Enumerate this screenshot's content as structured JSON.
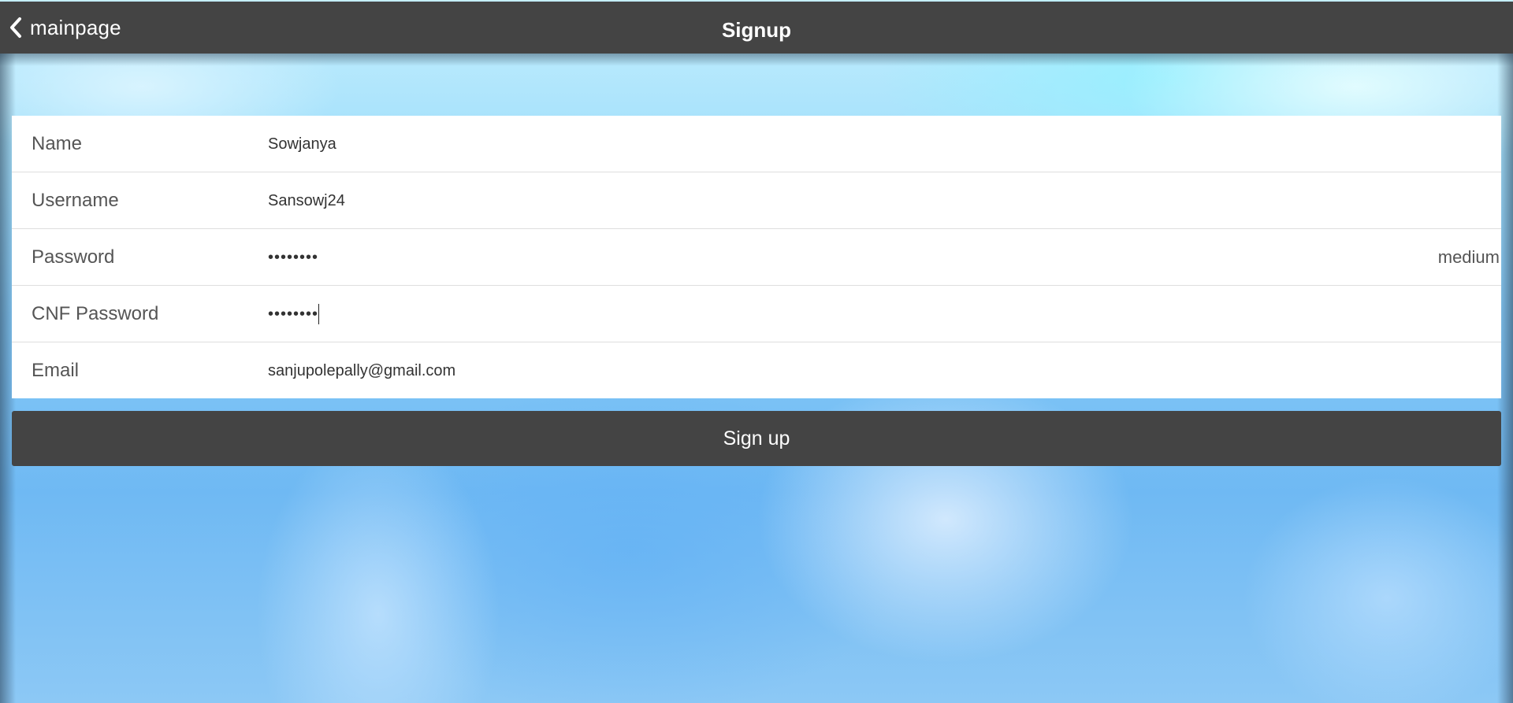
{
  "header": {
    "back_label": "mainpage",
    "back_icon": "chevron-left-icon",
    "title": "Signup"
  },
  "form": {
    "fields": [
      {
        "label": "Name",
        "value": "Sowjanya",
        "type": "text"
      },
      {
        "label": "Username",
        "value": "Sansowj24",
        "type": "text"
      },
      {
        "label": "Password",
        "value": "••••••••",
        "type": "password",
        "strength": "medium"
      },
      {
        "label": "CNF Password",
        "value": "••••••••",
        "type": "password"
      },
      {
        "label": "Email",
        "value": "sanjupolepally@gmail.com",
        "type": "email"
      }
    ]
  },
  "signup_button": {
    "label": "Sign up"
  },
  "colors": {
    "header_bg": "#444444",
    "button_bg": "#444444",
    "form_bg": "#ffffff"
  }
}
